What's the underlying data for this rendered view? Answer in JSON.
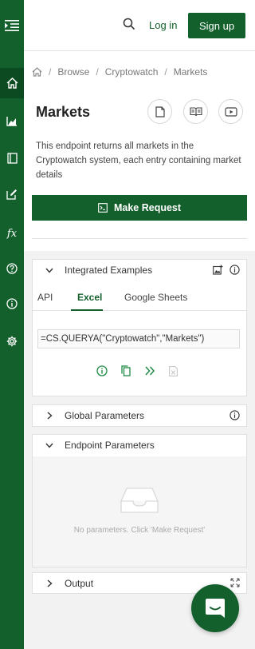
{
  "header": {
    "login_label": "Log in",
    "signup_label": "Sign up"
  },
  "sidebar": {
    "items": [
      {
        "icon": "home-icon",
        "active": true
      },
      {
        "icon": "chart-icon",
        "active": false
      },
      {
        "icon": "book-icon",
        "active": false
      },
      {
        "icon": "edit-icon",
        "active": false
      },
      {
        "icon": "function-icon",
        "label": "fx",
        "active": false
      },
      {
        "icon": "help-icon",
        "active": false
      },
      {
        "icon": "info-icon",
        "active": false
      },
      {
        "icon": "settings-icon",
        "active": false
      }
    ]
  },
  "breadcrumb": {
    "items": [
      "Browse",
      "Cryptowatch",
      "Markets"
    ]
  },
  "page": {
    "title": "Markets",
    "description": "This endpoint returns all markets in the Cryptowatch system, each entry containing market details",
    "make_request_label": "Make Request"
  },
  "integrated_examples": {
    "title": "Integrated Examples",
    "tabs": [
      "API",
      "Excel",
      "Google Sheets"
    ],
    "active_tab": "Excel",
    "formula": "=CS.QUERYA(\"Cryptowatch\",\"Markets\")"
  },
  "global_parameters": {
    "title": "Global Parameters"
  },
  "endpoint_parameters": {
    "title": "Endpoint Parameters",
    "empty_text": "No parameters. Click 'Make Request'"
  },
  "output": {
    "title": "Output"
  },
  "colors": {
    "brand": "#13602d",
    "sidebar_active": "#0c4a21"
  }
}
